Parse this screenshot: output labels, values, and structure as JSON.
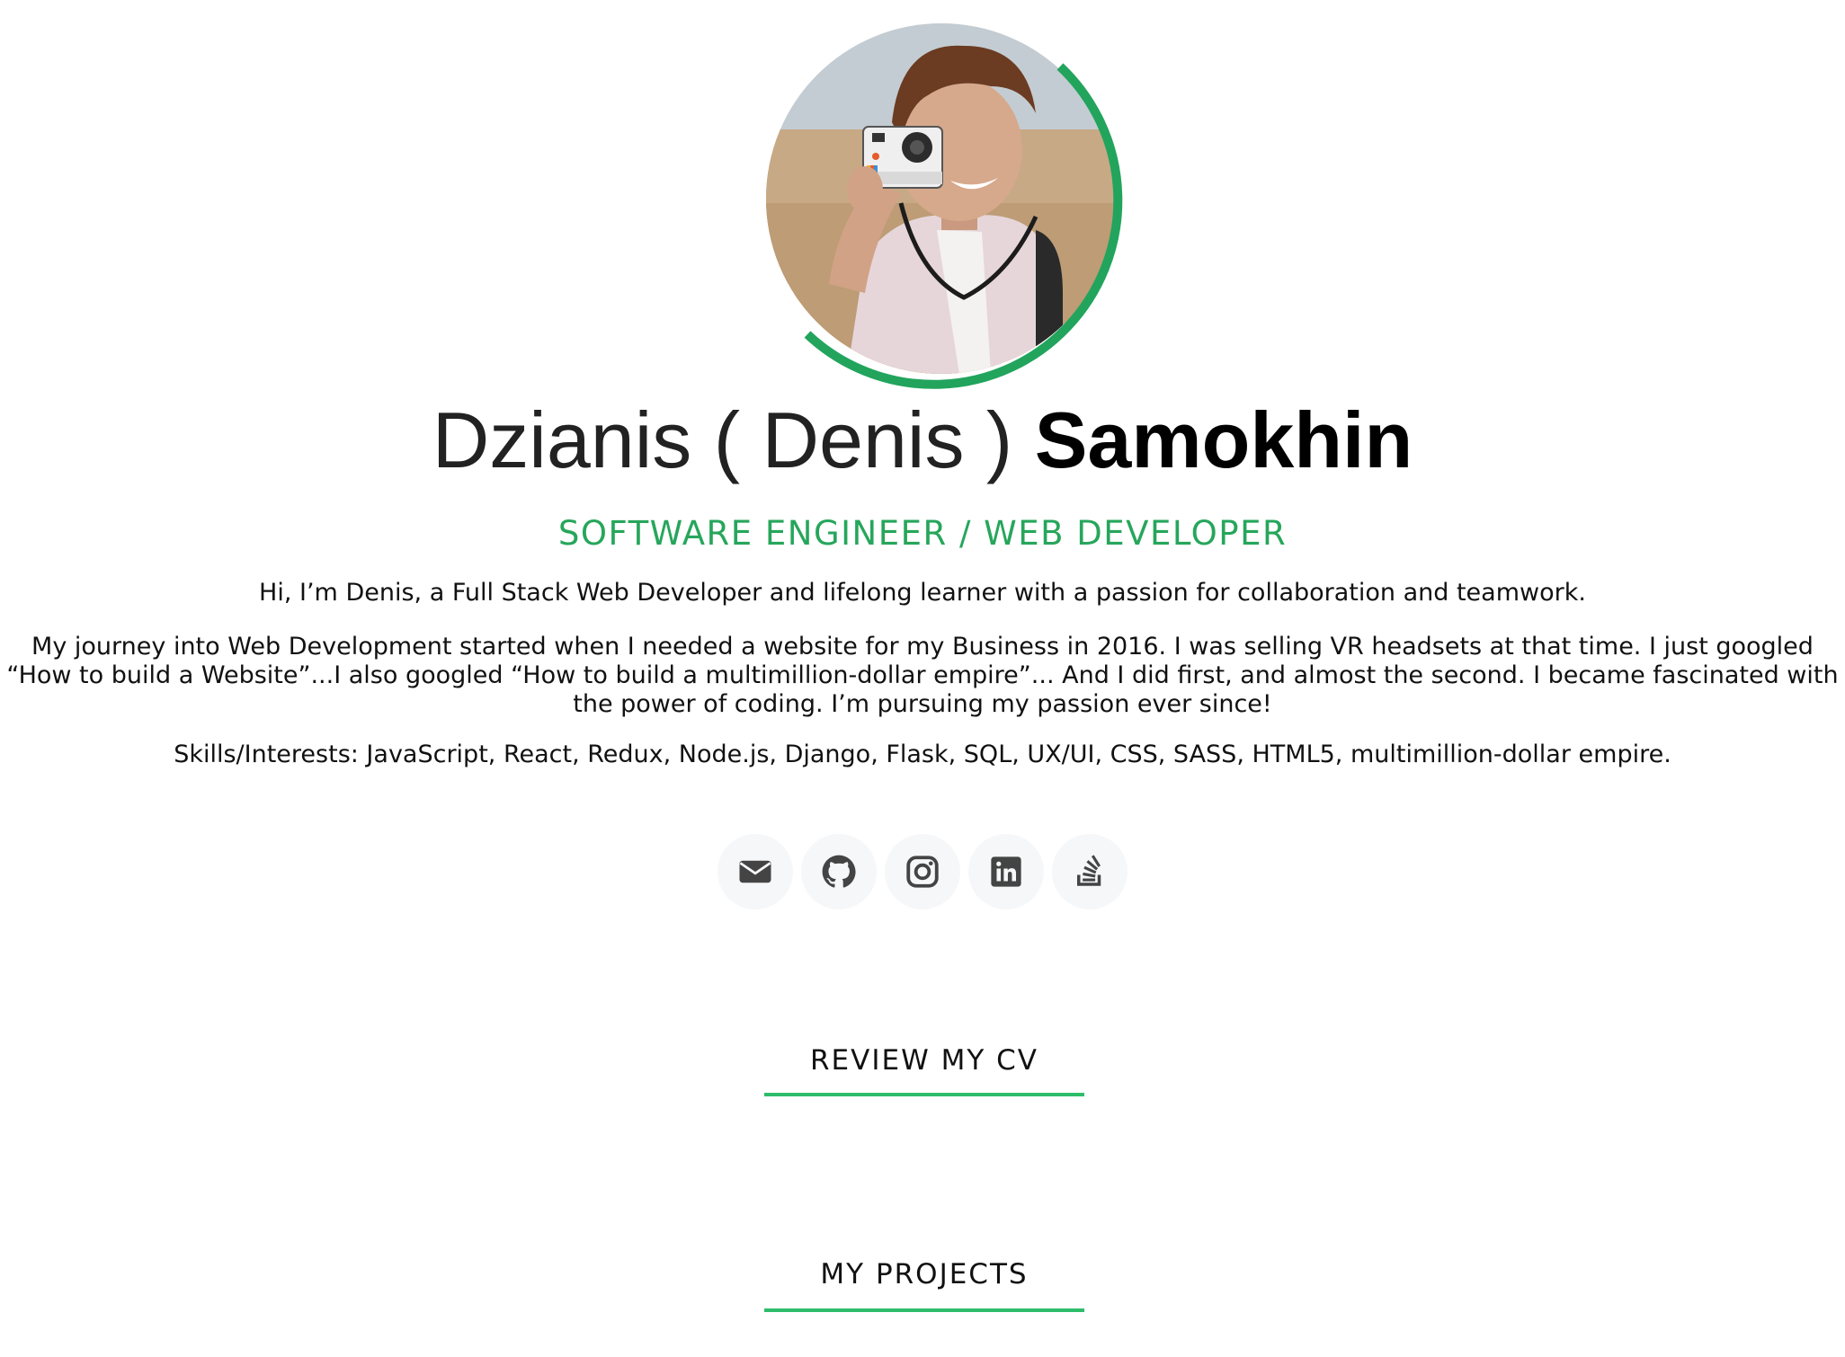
{
  "profile": {
    "name_first": "Dzianis ( Denis )",
    "name_last": "Samokhin",
    "role": "SOFTWARE ENGINEER / WEB DEVELOPER",
    "avatar_alt": "avatar-photo"
  },
  "bio": {
    "intro": "Hi, I’m Denis, a Full Stack Web Developer and lifelong learner with a passion for collaboration and teamwork.",
    "journey": "My journey into Web Development started when I needed a website for my Business in 2016. I was selling VR headsets at that time. I just googled “How to build a Website”...I also googled “How to build a multimillion-dollar empire”... And I did first, and almost the second. I became fascinated with the power of coding. I’m pursuing my passion ever since!",
    "skills": "Skills/Interests: JavaScript, React, Redux, Node.js, Django, Flask, SQL, UX/UI, CSS, SASS, HTML5, multimillion-dollar empire."
  },
  "socials": [
    {
      "icon": "envelope-icon"
    },
    {
      "icon": "github-icon"
    },
    {
      "icon": "instagram-icon"
    },
    {
      "icon": "linkedin-icon"
    },
    {
      "icon": "stackoverflow-icon"
    }
  ],
  "links": {
    "cv": "REVIEW MY CV",
    "projects": "MY PROJECTS"
  },
  "colors": {
    "accent": "#26a65b",
    "underline": "#2ebd6b",
    "icon": "#444444",
    "icon_bg": "#f6f7f9"
  }
}
